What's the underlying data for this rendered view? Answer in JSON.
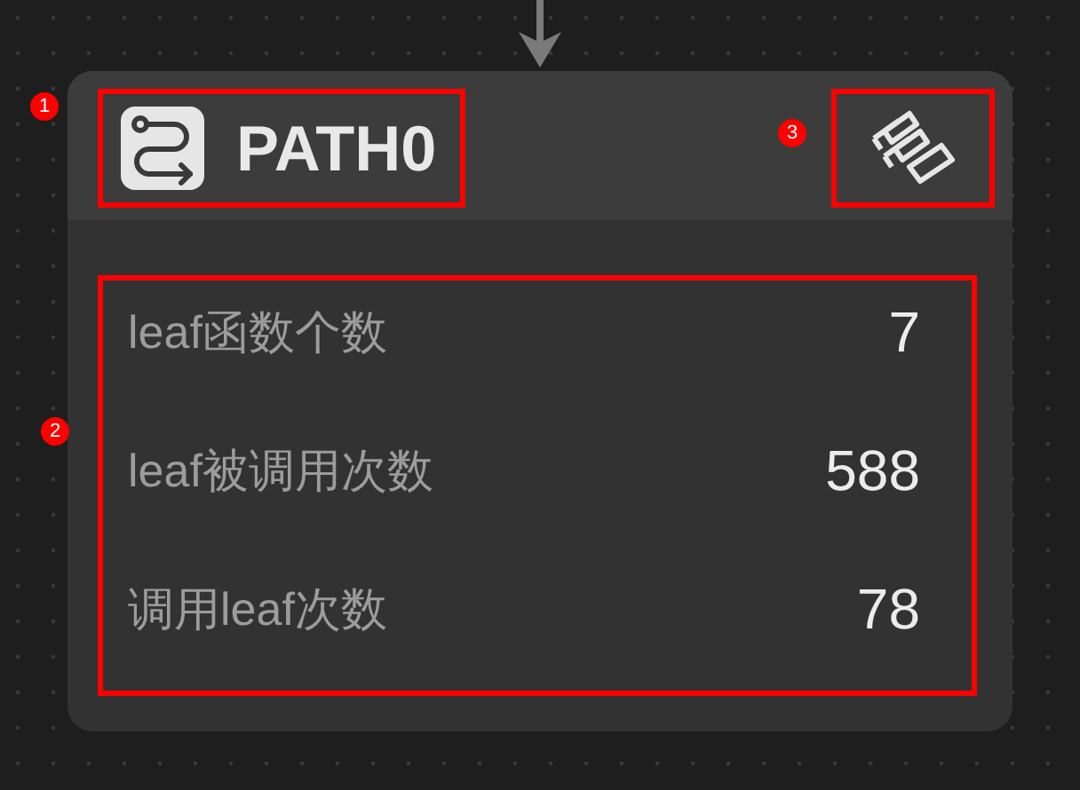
{
  "node": {
    "title": "PATH0",
    "stats": [
      {
        "label": "leaf函数个数",
        "value": "7"
      },
      {
        "label": "leaf被调用次数",
        "value": "588"
      },
      {
        "label": "调用leaf次数",
        "value": "78"
      }
    ]
  },
  "annotations": [
    {
      "number": "1"
    },
    {
      "number": "2"
    },
    {
      "number": "3"
    }
  ]
}
